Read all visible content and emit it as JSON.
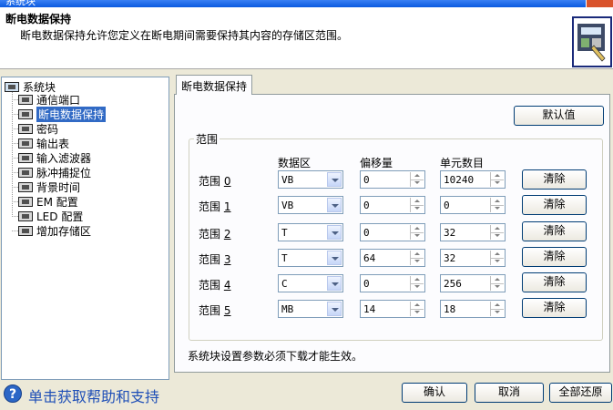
{
  "window": {
    "title": "系统块"
  },
  "header": {
    "title": "断电数据保持",
    "description": "断电数据保持允许您定义在断电期间需要保持其内容的存储区范围。"
  },
  "tree": {
    "root": "系统块",
    "items": [
      "通信端口",
      "断电数据保持",
      "密码",
      "输出表",
      "输入滤波器",
      "脉冲捕捉位",
      "背景时间",
      "EM 配置",
      "LED 配置",
      "增加存储区"
    ],
    "selected_index": 1
  },
  "tab": {
    "label": "断电数据保持"
  },
  "default_button": "默认值",
  "group": {
    "title": "范围",
    "columns": {
      "area": "数据区",
      "offset": "偏移量",
      "count": "单元数目"
    },
    "rows": [
      {
        "label": "范围",
        "index": "0",
        "area": "VB",
        "offset": "0",
        "count": "10240",
        "clear": "清除"
      },
      {
        "label": "范围",
        "index": "1",
        "area": "VB",
        "offset": "0",
        "count": "0",
        "clear": "清除"
      },
      {
        "label": "范围",
        "index": "2",
        "area": "T",
        "offset": "0",
        "count": "32",
        "clear": "清除"
      },
      {
        "label": "范围",
        "index": "3",
        "area": "T",
        "offset": "64",
        "count": "32",
        "clear": "清除"
      },
      {
        "label": "范围",
        "index": "4",
        "area": "C",
        "offset": "0",
        "count": "256",
        "clear": "清除"
      },
      {
        "label": "范围",
        "index": "5",
        "area": "MB",
        "offset": "14",
        "count": "18",
        "clear": "清除"
      }
    ]
  },
  "note": "系统块设置参数必须下载才能生效。",
  "footer": {
    "help": "单击获取帮助和支持",
    "ok": "确认",
    "cancel": "取消",
    "restore_all": "全部还原"
  }
}
